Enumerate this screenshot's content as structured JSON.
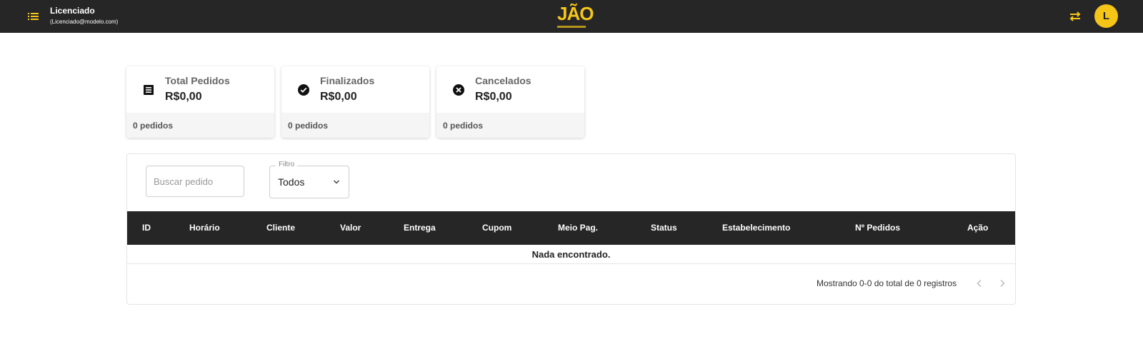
{
  "header": {
    "user_name": "Licenciado",
    "user_email": "(Licenciado@modelo.com)",
    "logo_text": "JÃO",
    "avatar_initial": "L",
    "accent_color": "#f5c518",
    "icons": [
      "menu-icon",
      "swap-icon"
    ]
  },
  "cards": [
    {
      "title": "Total Pedidos",
      "value": "R$0,00",
      "count": "0 pedidos",
      "icon": "list-icon"
    },
    {
      "title": "Finalizados",
      "value": "R$0,00",
      "count": "0 pedidos",
      "icon": "check-circle-icon"
    },
    {
      "title": "Cancelados",
      "value": "R$0,00",
      "count": "0 pedidos",
      "icon": "cancel-circle-icon"
    }
  ],
  "search": {
    "placeholder": "Buscar pedido",
    "value": ""
  },
  "filter": {
    "label": "Filtro",
    "selected": "Todos"
  },
  "table": {
    "columns": [
      "ID",
      "Horário",
      "Cliente",
      "Valor",
      "Entrega",
      "Cupom",
      "Meio Pag.",
      "Status",
      "Estabelecimento",
      "Nº Pedidos",
      "Ação"
    ],
    "empty_message": "Nada encontrado."
  },
  "pagination": {
    "info": "Mostrando 0-0 do total de 0 registros"
  }
}
